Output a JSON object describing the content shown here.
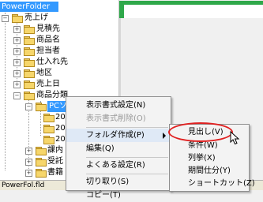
{
  "tree": {
    "root": "PowerFolder",
    "nodes": [
      "売上げ",
      "見積先",
      "商品名",
      "担当者",
      "仕入れ先",
      "地区",
      "売上日",
      "商品分類",
      "PCソフト",
      "200",
      "200",
      "200",
      "課内",
      "受託",
      "書籍"
    ]
  },
  "status_bar": {
    "text": "PowerFol.fld"
  },
  "context_menu": {
    "items": [
      "表示書式設定(N)",
      "表示書式削除(O)",
      "フォルダ作成(P)",
      "編集(Q)",
      "よくある設定(R)",
      "切り取り(S)",
      "コピー(T)"
    ]
  },
  "submenu": {
    "items": [
      "見出し(V)",
      "条件(W)",
      "列挙(X)",
      "期間仕分(Y)",
      "ショートカット(Z)"
    ]
  }
}
